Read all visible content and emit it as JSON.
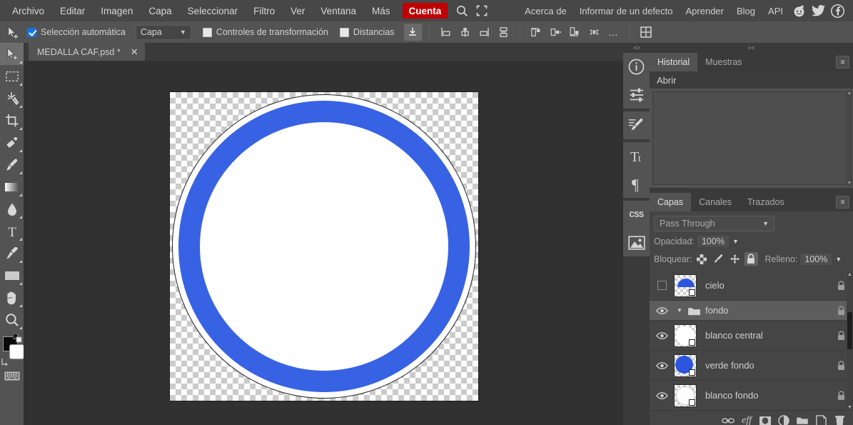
{
  "menubar": {
    "items": [
      {
        "label": "Archivo",
        "name": "menu-archivo"
      },
      {
        "label": "Editar",
        "name": "menu-editar"
      },
      {
        "label": "Imagen",
        "name": "menu-imagen"
      },
      {
        "label": "Capa",
        "name": "menu-capa"
      },
      {
        "label": "Seleccionar",
        "name": "menu-seleccionar"
      },
      {
        "label": "Filtro",
        "name": "menu-filtro"
      },
      {
        "label": "Ver",
        "name": "menu-ver"
      },
      {
        "label": "Ventana",
        "name": "menu-ventana"
      },
      {
        "label": "Más",
        "name": "menu-mas"
      }
    ],
    "account_label": "Cuenta",
    "account_color": "#c00000",
    "search_icon": "search-icon",
    "fullscreen_icon": "fullscreen-icon",
    "right_items": [
      {
        "label": "Acerca de",
        "name": "menu-acerca-de"
      },
      {
        "label": "Informar de un defecto",
        "name": "menu-informar-defecto"
      },
      {
        "label": "Aprender",
        "name": "menu-aprender"
      },
      {
        "label": "Blog",
        "name": "menu-blog"
      },
      {
        "label": "API",
        "name": "menu-api"
      }
    ],
    "social": [
      "reddit-icon",
      "twitter-icon",
      "facebook-icon"
    ]
  },
  "optionsbar": {
    "tool_icon": "move-tool-icon",
    "auto_select": {
      "label": "Selección automática",
      "checked": true
    },
    "scope_select": {
      "value": "Capa"
    },
    "transform_controls": {
      "label": "Controles de transformación",
      "checked": false
    },
    "distances": {
      "label": "Distancias",
      "checked": false
    },
    "align_buttons": [
      "align-download-icon",
      "align-left-edges-icon",
      "align-horizontal-centers-icon",
      "align-right-edges-icon",
      "align-vertical-centers-icon",
      "distribute-top-icon",
      "distribute-middle-icon",
      "distribute-bottom-icon",
      "distribute-spacing-icon",
      "more-options-icon",
      "grid-view-icon"
    ]
  },
  "toolbar": {
    "tools": [
      {
        "name": "move-tool",
        "selected": true
      },
      {
        "name": "rectangular-marquee-tool",
        "selected": false
      },
      {
        "name": "magic-wand-tool",
        "selected": false
      },
      {
        "name": "crop-tool",
        "selected": false
      },
      {
        "name": "eyedropper-tool",
        "selected": false
      },
      {
        "name": "paintbrush-tool",
        "selected": false
      },
      {
        "name": "gradient-tool",
        "selected": false
      },
      {
        "name": "blur-tool",
        "selected": false
      },
      {
        "name": "type-tool",
        "selected": false
      },
      {
        "name": "pen-tool",
        "selected": false
      },
      {
        "name": "shape-tool",
        "selected": false
      },
      {
        "name": "hand-tool",
        "selected": false
      },
      {
        "name": "zoom-tool",
        "selected": false
      }
    ],
    "foreground_color": "#0a0a0a",
    "background_color": "#fdfdfd",
    "keyboard_icon": "keyboard-shortcuts-icon"
  },
  "document": {
    "tab_title": "MEDALLA CAF.psd *",
    "close_icon": "close-icon"
  },
  "canvas": {
    "background": "#313131",
    "transparency_checker": true,
    "artwork": {
      "outer_ring_stroke": "#222222",
      "white_ring": "#ffffff",
      "blue_ring": "#3762e4",
      "center": "#ffffff"
    }
  },
  "rail": {
    "collapse_icon": "collapse-panels-icon",
    "buttons": [
      {
        "name": "info-icon"
      },
      {
        "name": "adjustments-icon"
      },
      {
        "name": "brush-settings-icon"
      },
      {
        "name": "character-icon"
      },
      {
        "name": "paragraph-icon"
      },
      {
        "name": "css-icon"
      },
      {
        "name": "image-icon"
      }
    ]
  },
  "history_panel": {
    "collapse_icon": "collapse-icon",
    "tabs": [
      {
        "label": "Historial",
        "active": true
      },
      {
        "label": "Muestras",
        "active": false
      }
    ],
    "menu_icon": "panel-menu-icon",
    "entries": [
      "Abrir"
    ]
  },
  "layers_panel": {
    "tabs": [
      {
        "label": "Capas",
        "active": true
      },
      {
        "label": "Canales",
        "active": false
      },
      {
        "label": "Trazados",
        "active": false
      }
    ],
    "menu_icon": "panel-menu-icon",
    "blend_mode": "Pass Through",
    "opacity_label": "Opacidad:",
    "opacity_value": "100%",
    "lock_label": "Bloquear:",
    "lock_buttons": [
      {
        "name": "lock-transparency-icon",
        "active": false
      },
      {
        "name": "lock-image-icon",
        "active": false
      },
      {
        "name": "lock-position-icon",
        "active": false
      },
      {
        "name": "lock-all-icon",
        "active": true
      }
    ],
    "fill_label": "Relleno:",
    "fill_value": "100%",
    "layers": [
      {
        "name": "cielo",
        "visible": false,
        "locked": true,
        "type": "layer",
        "thumb": "dome",
        "selected": false
      },
      {
        "name": "fondo",
        "visible": true,
        "locked": true,
        "type": "group",
        "selected": true
      },
      {
        "name": "blanco central",
        "visible": true,
        "locked": true,
        "type": "layer",
        "thumb": "white-circle",
        "selected": false
      },
      {
        "name": "verde fondo",
        "visible": true,
        "locked": true,
        "type": "layer",
        "thumb": "blue-circle",
        "selected": false
      },
      {
        "name": "blanco fondo",
        "visible": true,
        "locked": true,
        "type": "layer",
        "thumb": "dotted-circle",
        "selected": false
      }
    ],
    "footer_buttons": [
      {
        "name": "link-layers-icon"
      },
      {
        "name": "layer-effects-icon"
      },
      {
        "name": "layer-mask-icon"
      },
      {
        "name": "adjustment-layer-icon"
      },
      {
        "name": "new-group-icon"
      },
      {
        "name": "new-layer-icon"
      },
      {
        "name": "delete-layer-icon"
      }
    ]
  }
}
